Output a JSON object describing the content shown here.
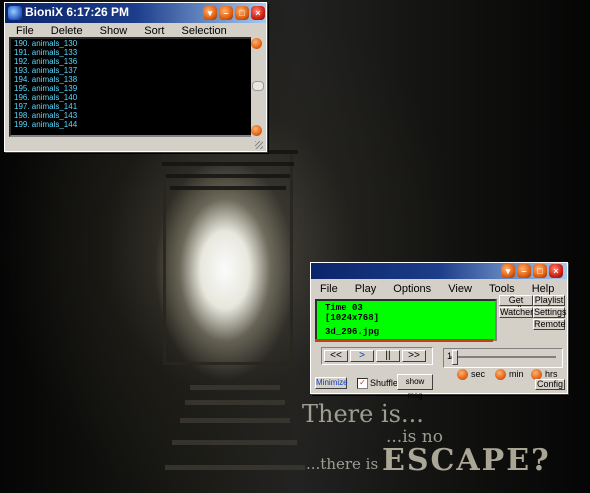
{
  "bionix": {
    "title": "BioniX  6:17:26 PM",
    "menu": [
      "File",
      "Delete",
      "Show",
      "Sort",
      "Selection"
    ],
    "list": [
      "190. animals_130",
      "191. animals_133",
      "192. animals_136",
      "193. animals_137",
      "194. animals_138",
      "195. animals_139",
      "196. animals_140",
      "197. animals_141",
      "198. animals_143",
      "199. animals_144"
    ]
  },
  "player": {
    "menu": [
      "File",
      "Play",
      "Options",
      "View",
      "Tools",
      "Help"
    ],
    "display": {
      "line1": "Time 03",
      "line2": "[1024x768]",
      "line3": "3d_296.jpg"
    },
    "transport": [
      "<<",
      ">",
      "||",
      ">>"
    ],
    "right_buttons": {
      "get_walls": "Get walls",
      "playlist": "Playlist",
      "watcher": "Watcher",
      "settings": "Settings",
      "remote": "Remote"
    },
    "slider_value": "1",
    "units": [
      "sec",
      "min",
      "hrs"
    ],
    "minimize": "Minimize",
    "shuffle": "Shuffle",
    "show_msg": "show msg",
    "config": "Config"
  },
  "wallpaper": {
    "line1": "There is...",
    "line2": "...is no",
    "line3_prefix": "...there is",
    "line3_word": "ESCAPE?"
  }
}
